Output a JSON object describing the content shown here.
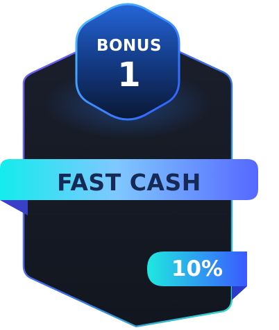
{
  "card": {
    "badge_word": "BONUS",
    "badge_number": "1",
    "ribbon_label": "FAST CASH",
    "percentage": "10%"
  },
  "colors": {
    "card_fill": "#161b28",
    "card_border_start": "#7b5cff",
    "card_border_end": "#2fe0c8",
    "hex_fill_top": "#1e5cc8",
    "hex_fill_bottom": "#0b1a3a",
    "hex_border": "#33a8ff",
    "ribbon_start": "#1de6e6",
    "ribbon_end": "#5a6cff",
    "ribbon_text": "#152a54",
    "pill_start": "#1fe5e0",
    "pill_end": "#3a5cff",
    "pill_text": "#ffffff"
  }
}
